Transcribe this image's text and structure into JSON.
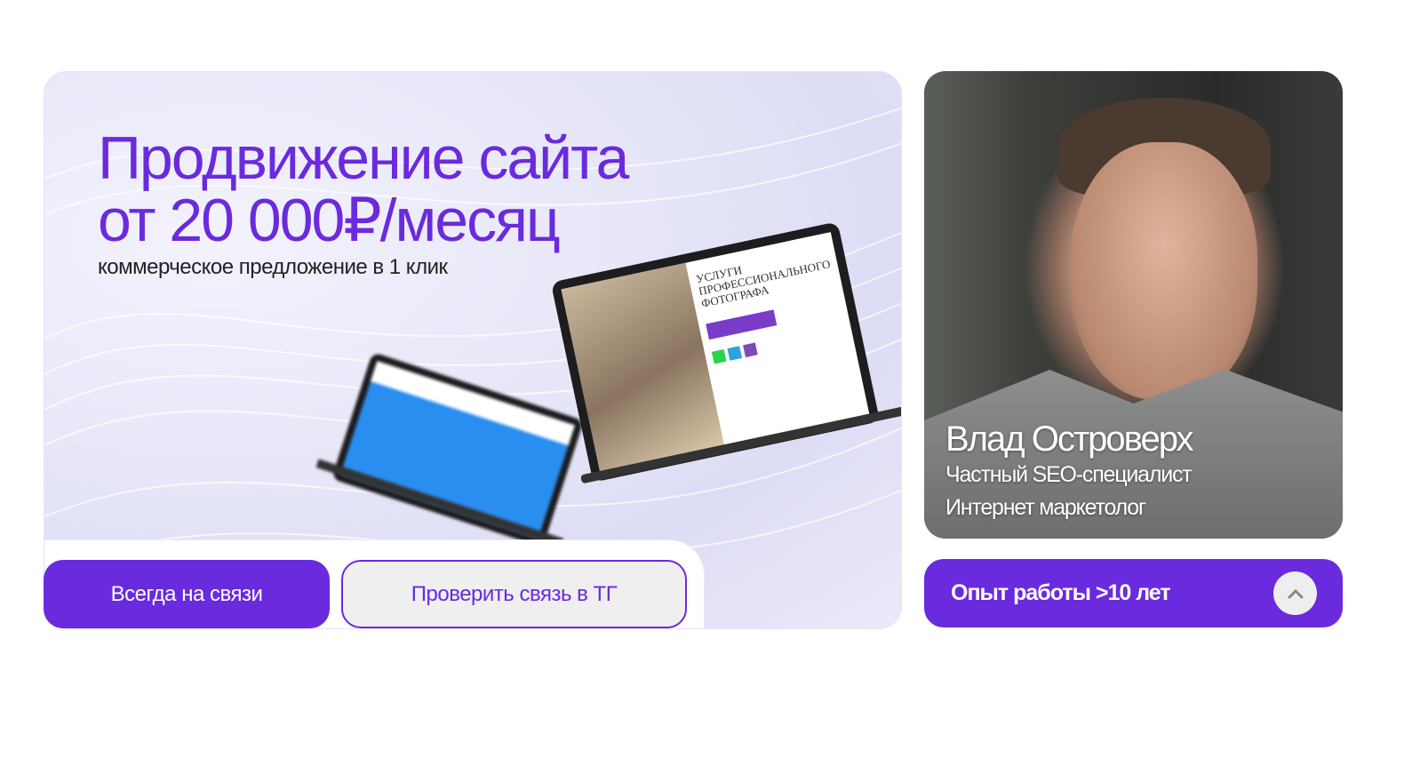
{
  "hero": {
    "title_line1": "Продвижение сайта",
    "title_line2": "от 20 000₽/месяц",
    "subtitle": "коммерческое предложение в 1 клик",
    "mockup_heading": "УСЛУГИ ПРОФЕССИОНАЛЬНОГО ФОТОГРАФА"
  },
  "buttons": {
    "contact": "Всегда на связи",
    "check_tg": "Проверить связь в ТГ"
  },
  "profile": {
    "name": "Влад Островерх",
    "role1": "Частный SEO-специалист",
    "role2": "Интернет маркетолог",
    "experience": "Опыт работы >10 лет"
  },
  "colors": {
    "accent": "#6a2ade"
  }
}
